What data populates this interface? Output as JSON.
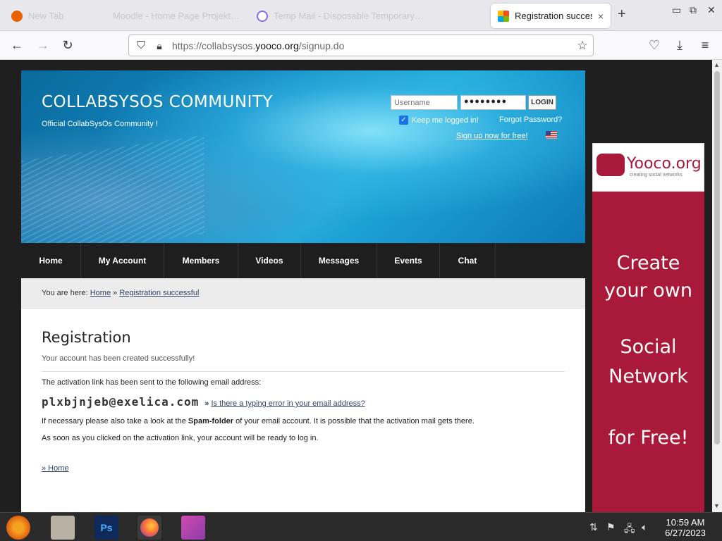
{
  "browser": {
    "tabs": [
      {
        "label": "New Tab"
      },
      {
        "label": "Moodle - Home Page Projekt…"
      },
      {
        "label": "Temp Mail - Disposable Temporary…"
      },
      {
        "label": "Registration succes"
      }
    ],
    "active_tab_close": "×",
    "new_tab": "+",
    "url_prefix": "https://collabsysos.",
    "url_domain": "yooco.org",
    "url_path": "/signup.do"
  },
  "site": {
    "title": "COLLABSYSOS COMMUNITY",
    "subtitle": "Official CollabSysOs Community !",
    "login": {
      "username_placeholder": "Username",
      "password_value": "●●●●●●●●",
      "button": "LOGIN",
      "keep_logged_in": "Keep me logged in!",
      "keep_logged_in_checked": true,
      "forgot": "Forgot Password?",
      "signup": "Sign up now for free!"
    },
    "menu": [
      "Home",
      "My Account",
      "Members",
      "Videos",
      "Messages",
      "Events",
      "Chat"
    ],
    "breadcrumb": {
      "prefix": "You are here:",
      "home": "Home",
      "sep": "»",
      "current": "Registration successful"
    },
    "content": {
      "heading": "Registration",
      "success": "Your account has been created successfully!",
      "activation_sent": "The activation link has been sent to the following email address:",
      "email": "plxbjnjeb@exelica.com",
      "typo_prefix": "»",
      "typo_link": "Is there a typing error in your email address?",
      "spam_before": "If necessary please also take a look at the ",
      "spam_bold": "Spam-folder",
      "spam_after": " of your email account. It is possible that the activation mail gets there.",
      "ready": "As soon as you clicked on the activation link, your account will be ready to log in.",
      "home_link": "» Home"
    }
  },
  "ad": {
    "logo": "Yooco.org",
    "tagline": "creating social networks",
    "lines": [
      "Create",
      "your own",
      "Social",
      "Network",
      "for Free!"
    ]
  },
  "taskbar": {
    "time": "10:59 AM",
    "date": "6/27/2023",
    "ps_label": "Ps"
  },
  "colors": {
    "brand_red": "#a91a3a",
    "menu_bg": "#1e1e1e",
    "header_blue": "#1186c0"
  }
}
